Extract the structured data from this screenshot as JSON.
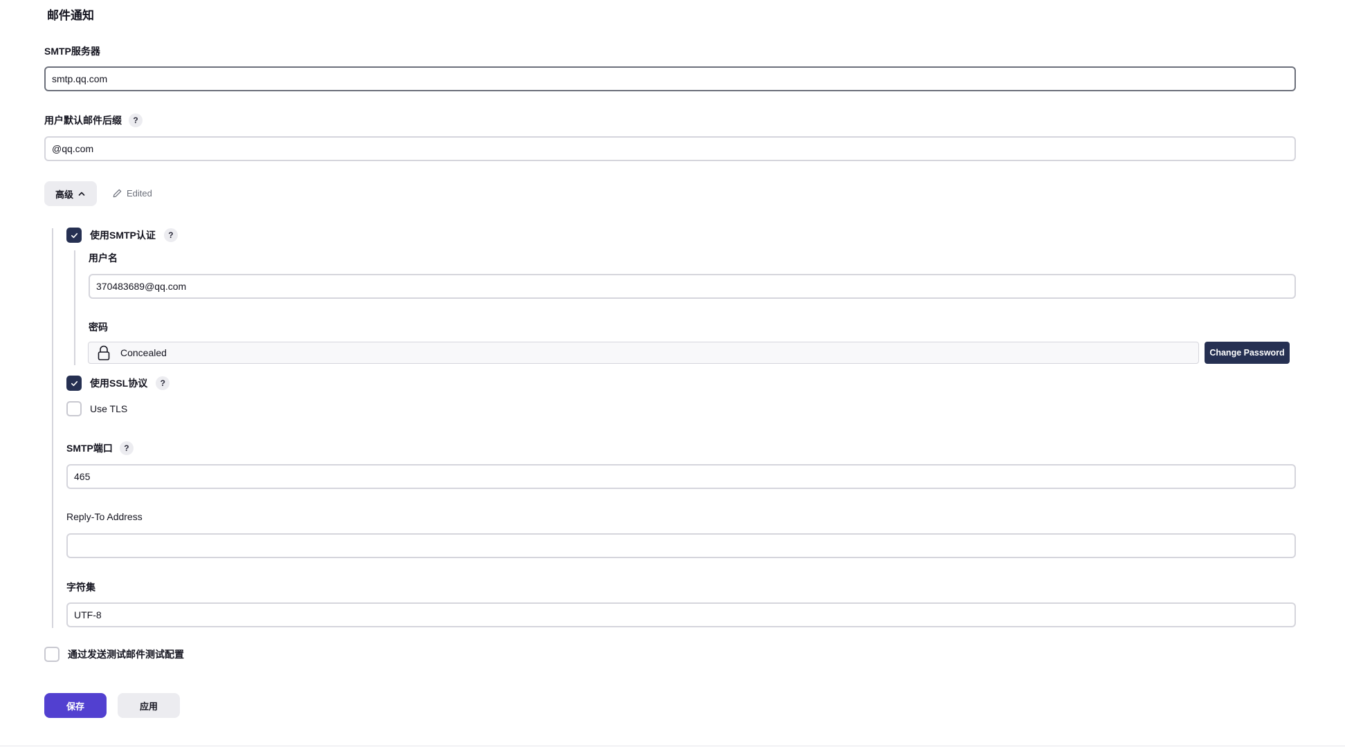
{
  "section": {
    "title": "邮件通知"
  },
  "smtp_server": {
    "label": "SMTP服务器",
    "value": "smtp.qq.com"
  },
  "default_suffix": {
    "label": "用户默认邮件后缀",
    "help": "?",
    "value": "@qq.com"
  },
  "advanced": {
    "label": "高级",
    "edited_label": "Edited",
    "expanded": true
  },
  "smtp_auth": {
    "label": "使用SMTP认证",
    "help": "?",
    "checked": true,
    "username": {
      "label": "用户名",
      "value": "370483689@qq.com"
    },
    "password": {
      "label": "密码",
      "status": "Concealed",
      "change_button": "Change Password"
    }
  },
  "use_ssl": {
    "label": "使用SSL协议",
    "help": "?",
    "checked": true
  },
  "use_tls": {
    "label": "Use TLS",
    "checked": false
  },
  "smtp_port": {
    "label": "SMTP端口",
    "help": "?",
    "value": "465"
  },
  "reply_to": {
    "label": "Reply-To Address",
    "value": ""
  },
  "charset": {
    "label": "字符集",
    "value": "UTF-8"
  },
  "test_config": {
    "label": "通过发送测试邮件测试配置",
    "checked": false
  },
  "actions": {
    "save": "保存",
    "apply": "应用"
  },
  "colors": {
    "primary": "#5240d0",
    "navy": "#263052",
    "border": "#d5d5dc",
    "muted": "#ececf0"
  }
}
